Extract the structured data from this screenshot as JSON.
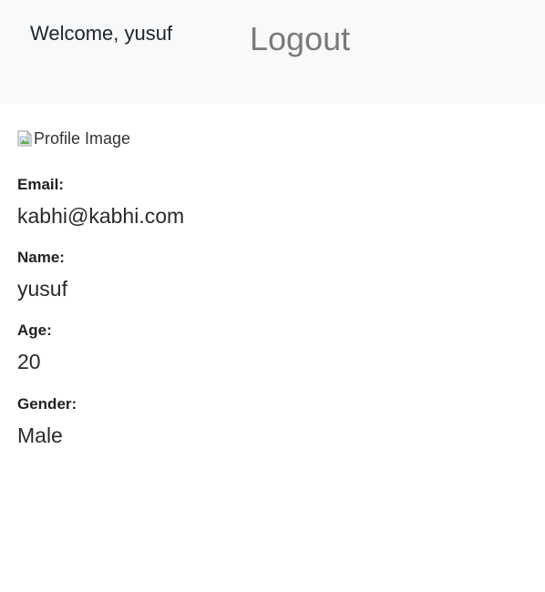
{
  "header": {
    "welcome_text": "Welcome, yusuf",
    "logout_label": "Logout"
  },
  "profile": {
    "image_alt": "Profile Image",
    "fields": [
      {
        "label": "Email:",
        "value": "kabhi@kabhi.com"
      },
      {
        "label": "Name:",
        "value": "yusuf"
      },
      {
        "label": "Age:",
        "value": "20"
      },
      {
        "label": "Gender:",
        "value": "Male"
      }
    ]
  },
  "colors": {
    "navbar_bg": "#f8f9fa",
    "logout_text": "#7a7a7a",
    "body_text": "#222222"
  },
  "icons": {
    "profile_image": "broken-image-icon"
  }
}
